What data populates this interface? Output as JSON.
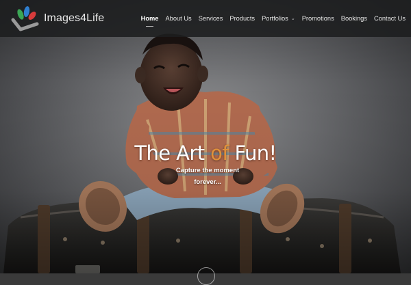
{
  "brand": {
    "name": "Images4Life",
    "colors": {
      "leaf_green": "#3aa655",
      "leaf_blue": "#2f7fd0",
      "leaf_red": "#d83b3b",
      "check_grey": "#9a9a9a"
    }
  },
  "nav": {
    "items": [
      {
        "label": "Home",
        "active": true
      },
      {
        "label": "About Us"
      },
      {
        "label": "Services"
      },
      {
        "label": "Products"
      },
      {
        "label": "Portfolios",
        "dropdown": true
      },
      {
        "label": "Promotions"
      },
      {
        "label": "Bookings"
      },
      {
        "label": "Contact Us"
      }
    ],
    "dropdown_icon": "chevron-down-icon"
  },
  "hero": {
    "headline_part1": "The Art",
    "headline_part2": "of",
    "headline_part3": "Fun!",
    "tagline": "Capture the moment forever...",
    "accent_color": "#e0903a"
  }
}
